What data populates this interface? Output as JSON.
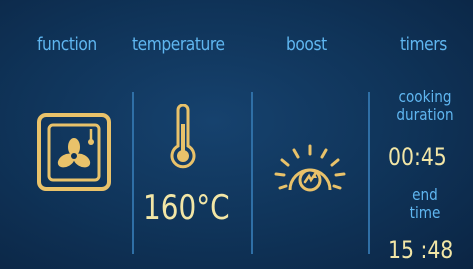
{
  "header": {
    "function": "function",
    "temperature": "temperature",
    "boost": "boost",
    "timers": "timers"
  },
  "function": {
    "icon": "oven-fan-icon"
  },
  "temperature": {
    "icon": "thermometer-icon",
    "value": "160°C"
  },
  "boost": {
    "icon": "boost-sun-icon"
  },
  "timers": {
    "cooking_duration_line1": "cooking",
    "cooking_duration_line2": "duration",
    "cooking_duration_value": "00:45",
    "end_time_line1": "end",
    "end_time_line2": "time",
    "end_time_value": "15 :48"
  },
  "colors": {
    "background": "#0f3358",
    "label": "#5fb6f0",
    "value": "#f2e6a6",
    "icon": "#e9c26a",
    "divider": "#2f6fa6"
  }
}
